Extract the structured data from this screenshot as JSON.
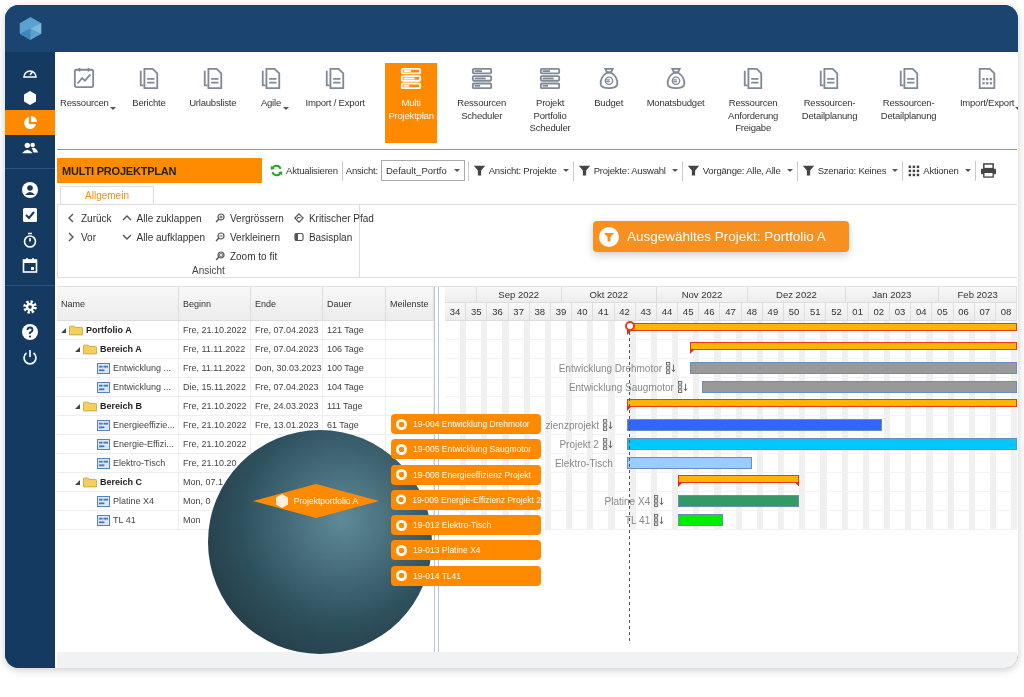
{
  "sidebar": {
    "groups": [
      [
        {
          "selected": false
        },
        {
          "selected": false
        },
        {
          "selected": true
        },
        {
          "selected": false
        }
      ],
      [
        {
          "selected": false
        },
        {
          "selected": false
        },
        {
          "selected": false
        },
        {
          "selected": false
        }
      ],
      [
        {
          "selected": false
        },
        {
          "selected": false
        },
        {
          "selected": false
        }
      ]
    ]
  },
  "ribbon": [
    {
      "label": "Ressourcen",
      "selected": false,
      "dropdown": true
    },
    {
      "label": "Berichte",
      "selected": false,
      "dropdown": false
    },
    {
      "label": "Urlaubsliste",
      "selected": false,
      "dropdown": false
    },
    {
      "label": "Agile",
      "selected": false,
      "dropdown": true
    },
    {
      "label": "Import / Export",
      "selected": false,
      "dropdown": false
    },
    {
      "label": "Multi\nProjektplan",
      "selected": true,
      "dropdown": false
    },
    {
      "label": "Ressourcen\nScheduler",
      "selected": false,
      "dropdown": false
    },
    {
      "label": "Projekt\nPortfolio\nScheduler",
      "selected": false,
      "dropdown": false
    },
    {
      "label": "Budget",
      "selected": false,
      "dropdown": false
    },
    {
      "label": "Monatsbudget",
      "selected": false,
      "dropdown": false
    },
    {
      "label": "Ressourcen\nAnforderung\nFreigabe",
      "selected": false,
      "dropdown": false
    },
    {
      "label": "Ressourcen-\nDetailplanung",
      "selected": false,
      "dropdown": false
    },
    {
      "label": "Ressourcen-\nDetailplanung",
      "selected": false,
      "dropdown": false
    },
    {
      "label": "Import/Export",
      "selected": false,
      "dropdown": true
    }
  ],
  "toolbar": {
    "title": "MULTI PROJEKTPLAN",
    "refresh": "Aktualisieren",
    "view_label": "Ansicht:",
    "view_select": "Default_Portfo",
    "filters": [
      "Ansicht: Projekte",
      "Projekte: Auswahl",
      "Vorgänge: Alle, Alle",
      "Szenario: Keines"
    ],
    "actions": "Aktionen"
  },
  "tabs": [
    {
      "label": "Allgemein",
      "selected": true
    }
  ],
  "ribbon_group": {
    "label": "Ansicht",
    "columns": [
      [
        "Zurück",
        "Vor"
      ],
      [
        "Alle zuklappen",
        "Alle aufklappen"
      ],
      [
        "Vergrössern",
        "Verkleinern",
        "Zoom to fit"
      ],
      [
        "Kritischer Pfad",
        "Basisplan"
      ]
    ]
  },
  "callout": "Ausgewähltes Projekt: Portfolio A",
  "table": {
    "columns": [
      "Name",
      "Beginn",
      "Ende",
      "Dauer",
      "Meilenste"
    ],
    "rows": [
      {
        "name": "Portfolio A",
        "kind": "group",
        "expanded": true,
        "begin": "Fre, 21.10.2022",
        "end": "Fre, 07.04.2023",
        "duration": "121 Tage",
        "children": [
          {
            "name": "Bereich A",
            "kind": "group",
            "expanded": true,
            "begin": "Fre, 11.11.2022",
            "end": "Fre, 07.04.2023",
            "duration": "106 Tage",
            "children": [
              {
                "name": "Entwicklung ...",
                "kind": "task",
                "begin": "Fre, 11.11.2022",
                "end": "Don, 30.03.2023",
                "duration": "100 Tage",
                "gantt_label": "Entwicklung Drehmotor",
                "subplan_icon": true,
                "color": "#999999"
              },
              {
                "name": "Entwicklung ...",
                "kind": "task",
                "begin": "Die, 15.11.2022",
                "end": "Fre, 07.04.2023",
                "duration": "104 Tage",
                "gantt_label": "Entwicklung Saugmotor",
                "subplan_icon": true,
                "color": "#999999"
              }
            ]
          },
          {
            "name": "Bereich B",
            "kind": "group",
            "expanded": true,
            "begin": "Fre, 21.10.2022",
            "end": "Fre, 24.03.2023",
            "duration": "111 Tage",
            "children": [
              {
                "name": "Energieeffizie...",
                "kind": "task",
                "begin": "Fre, 21.10.2022",
                "end": "Fre, 13.01.2023",
                "duration": "61 Tage",
                "gantt_label": "zienzprojekt",
                "subplan_icon": true,
                "color": "#3366ff"
              },
              {
                "name": "Energie-Effizi...",
                "kind": "task",
                "begin": "Fre, 21.10.2022",
                "gantt_label": "Projekt 2",
                "subplan_icon": true,
                "color": "#00c8ff"
              },
              {
                "name": "Elektro-Tisch",
                "kind": "task",
                "begin": "Fre, 21.10.20",
                "gantt_label": "Elektro-Tisch",
                "subplan_icon": false,
                "color": "#99ccff"
              }
            ]
          },
          {
            "name": "Bereich C",
            "kind": "group",
            "expanded": true,
            "begin": "Mon, 07.1",
            "children": [
              {
                "name": "Platine X4",
                "kind": "task",
                "begin": "Mon, 0",
                "gantt_label": "Platine X4",
                "subplan_icon": true,
                "color": "#339966"
              },
              {
                "name": "TL 41",
                "kind": "task",
                "begin": "Mon",
                "gantt_label": "TL 41",
                "subplan_icon": true,
                "color": "#00ee00"
              }
            ]
          }
        ]
      }
    ]
  },
  "gantt": {
    "months": [
      "Sep 2022",
      "Okt 2022",
      "Nov 2022",
      "Dez 2022",
      "Jan 2023",
      "Feb 2023"
    ],
    "weeks": [
      "34",
      "35",
      "36",
      "37",
      "38",
      "39",
      "40",
      "41",
      "42",
      "43",
      "44",
      "45",
      "46",
      "47",
      "48",
      "49",
      "50",
      "51",
      "52",
      "01",
      "02",
      "03",
      "04",
      "05",
      "06",
      "07",
      "08"
    ]
  },
  "overlay": {
    "portfolio": "Projektportfolio A",
    "projects": [
      "19-004 Entwicklung Drehmotor",
      "19-005 Entwicklung Saugmotor",
      "19-008 Energieeffizienz Projekt",
      "19-009 Energie-Effizienz Projekt 2",
      "19-012 Elektro-Tisch",
      "19-013 Platine X4",
      "19-014 TL41"
    ]
  }
}
